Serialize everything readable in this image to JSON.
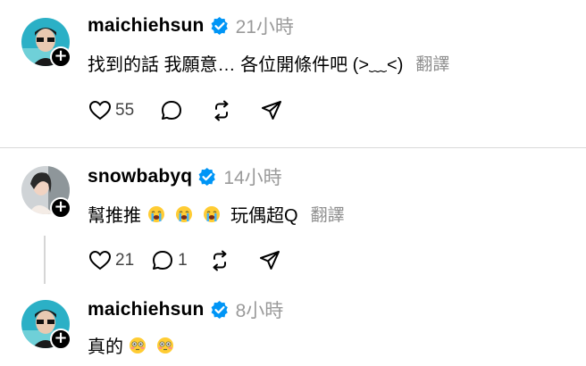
{
  "posts": [
    {
      "username": "maichiehsun",
      "time": "21小時",
      "text": "找到的話 我願意… 各位開條件吧 (>﹏<)",
      "translate": "翻譯",
      "likes": "55",
      "comments": "",
      "emoji_count": 0
    },
    {
      "username": "snowbabyq",
      "time": "14小時",
      "text_before": "幫推推",
      "text_after": "玩偶超Q",
      "translate": "翻譯",
      "likes": "21",
      "comments": "1",
      "emoji_count": 3
    },
    {
      "username": "maichiehsun",
      "time": "8小時",
      "text_before": "真的",
      "emoji_count": 2
    }
  ],
  "icons": {
    "like": "heart-icon",
    "comment": "comment-icon",
    "repost": "repost-icon",
    "share": "share-icon",
    "verified": "verified-badge-icon",
    "follow": "plus-icon"
  },
  "colors": {
    "verified": "#0095f6",
    "muted": "#9a9a9a"
  }
}
